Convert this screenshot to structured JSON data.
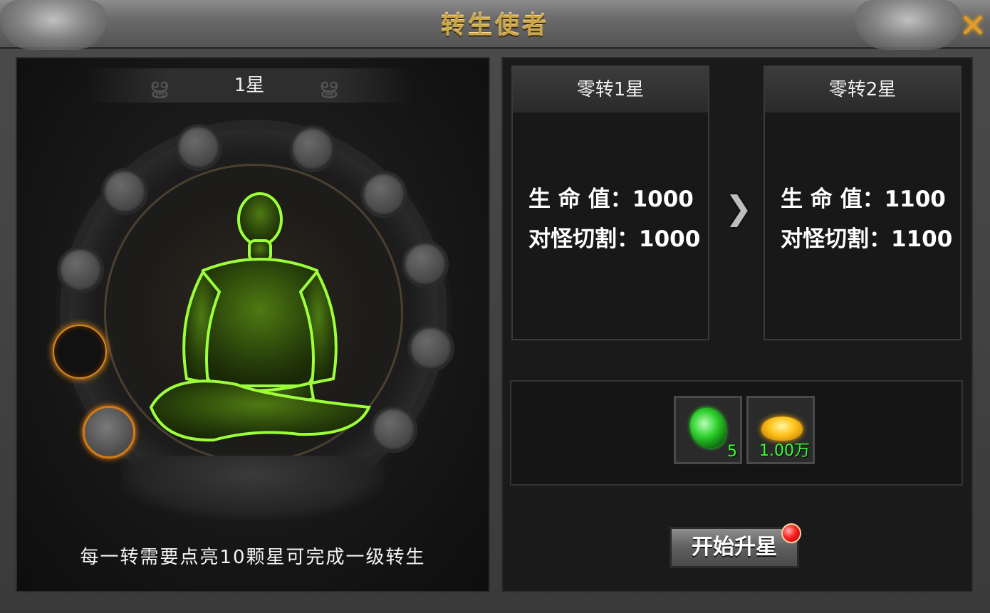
{
  "window": {
    "title": "转生使者",
    "close_icon": "close-icon"
  },
  "left_panel": {
    "star_title": "1星",
    "hint": "每一转需要点亮10颗星可完成一级转生",
    "stars_total": 10,
    "stars_lit": 1
  },
  "current": {
    "title": "零转1星",
    "stats": [
      {
        "label": "生 命 值：",
        "value": "1000"
      },
      {
        "label": "对怪切割：",
        "value": "1000"
      }
    ]
  },
  "next": {
    "title": "零转2星",
    "stats": [
      {
        "label": "生 命 值：",
        "value": "1100"
      },
      {
        "label": "对怪切割：",
        "value": "1100"
      }
    ]
  },
  "cost": [
    {
      "icon": "green-gem-icon",
      "quantity": "5"
    },
    {
      "icon": "gold-ingot-icon",
      "quantity": "1.00万"
    }
  ],
  "start_button": {
    "label": "开始升星",
    "has_notification": true
  },
  "colors": {
    "title_gold": "#c9a64a",
    "quantity_green": "#35ff35",
    "glow_orange": "#ff9a1a",
    "figure_green": "#8aff3a"
  }
}
